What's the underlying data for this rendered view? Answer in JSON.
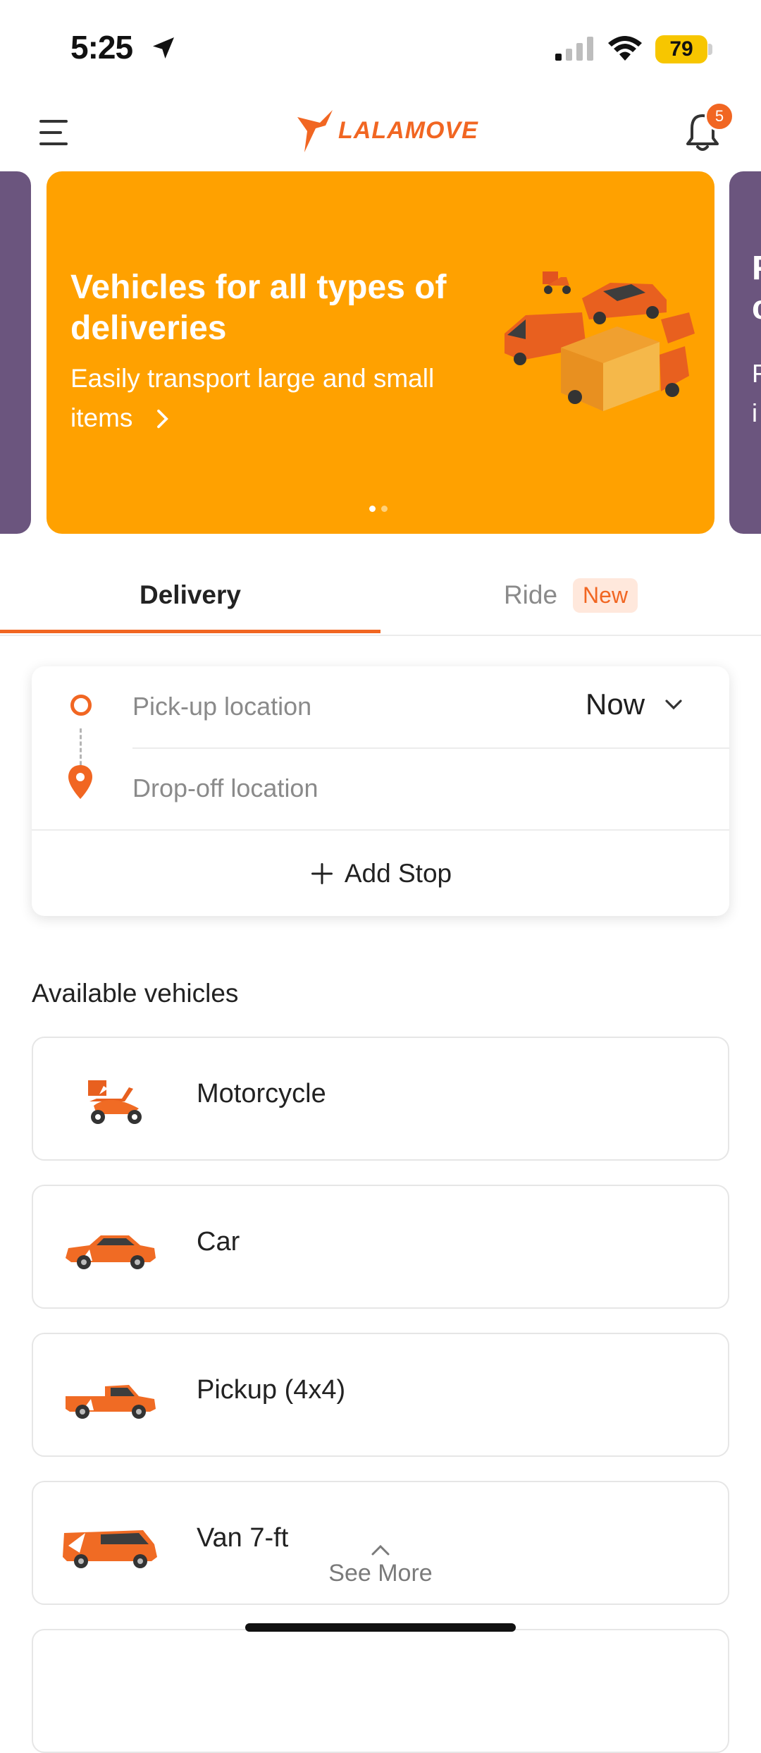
{
  "status_bar": {
    "time": "5:25",
    "battery": "79"
  },
  "header": {
    "logo_text": "LALAMOVE",
    "notification_count": "5"
  },
  "banner": {
    "title": "Vehicles for all types of deliveries",
    "subtitle": "Easily transport large and small items",
    "page_dots": 2,
    "active_dot": 1,
    "next_peek_letters": [
      "F",
      "c",
      "F",
      "i"
    ]
  },
  "tabs": {
    "delivery": "Delivery",
    "ride": "Ride",
    "ride_badge": "New"
  },
  "location": {
    "pickup_placeholder": "Pick-up location",
    "dropoff_placeholder": "Drop-off location",
    "time_selector": "Now",
    "add_stop": "Add Stop"
  },
  "vehicles": {
    "section_title": "Available vehicles",
    "items": [
      {
        "name": "Motorcycle",
        "icon": "motorcycle-icon"
      },
      {
        "name": "Car",
        "icon": "car-icon"
      },
      {
        "name": "Pickup (4x4)",
        "icon": "pickup-truck-icon"
      },
      {
        "name": "Van 7-ft",
        "icon": "van-icon"
      }
    ],
    "see_more": "See More"
  },
  "colors": {
    "brand_orange": "#f16622",
    "banner_yellow": "#ffa100",
    "banner_purple": "#6b557e"
  }
}
